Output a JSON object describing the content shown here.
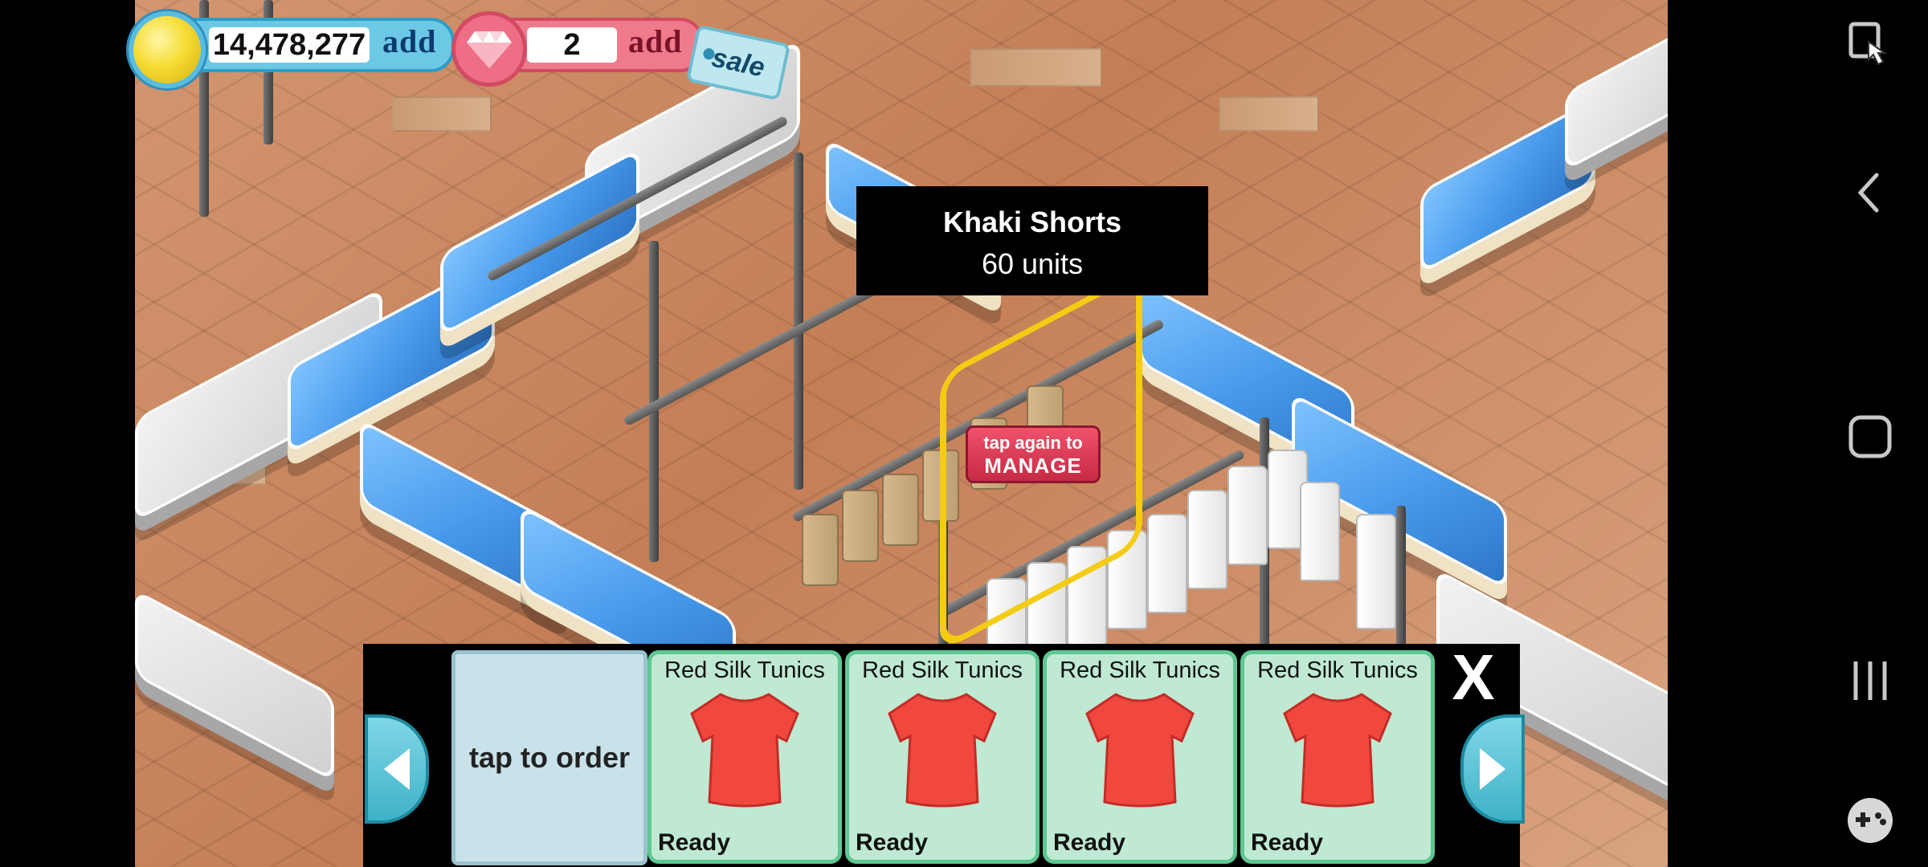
{
  "hud": {
    "coins": "14,478,277",
    "coin_add": "add",
    "gems": "2",
    "gem_add": "add",
    "sale": "sale"
  },
  "tooltip": {
    "title": "Khaki Shorts",
    "subtitle": "60 units"
  },
  "manage": {
    "line1": "tap again to",
    "line2": "MANAGE"
  },
  "panel": {
    "order_label": "tap to order",
    "items": [
      {
        "name": "Red Silk Tunics",
        "status": "Ready"
      },
      {
        "name": "Red Silk Tunics",
        "status": "Ready"
      },
      {
        "name": "Red Silk Tunics",
        "status": "Ready"
      },
      {
        "name": "Red Silk Tunics",
        "status": "Ready"
      }
    ],
    "close": "X"
  },
  "icons": {
    "coin": "coin-icon",
    "gem": "gem-icon",
    "left": "arrow-left-icon",
    "right": "arrow-right-icon",
    "tunic": "red-tunic-icon"
  },
  "colors": {
    "accent_green": "#5ec792",
    "tunic_red": "#f0473f",
    "highlight_yellow": "#f4cc13"
  }
}
